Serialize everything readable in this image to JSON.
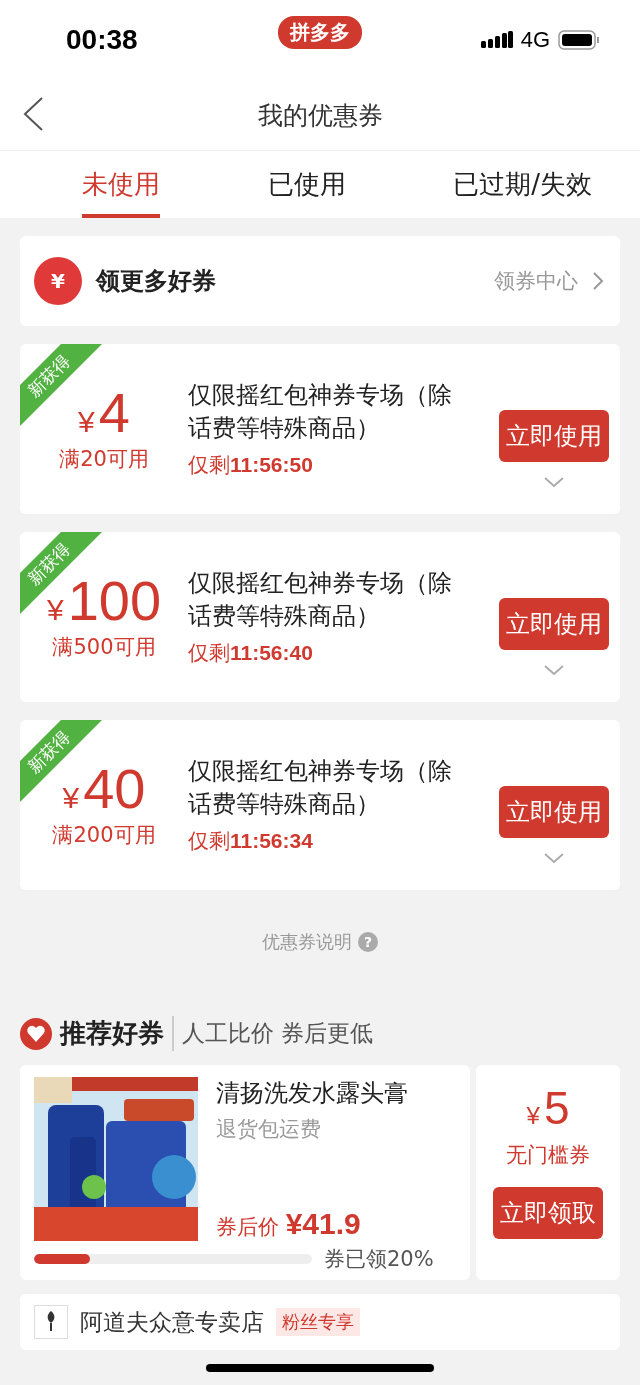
{
  "status_bar": {
    "time": "00:38",
    "app_badge": "拼多多",
    "network": "4G"
  },
  "nav": {
    "title": "我的优惠券"
  },
  "tabs": [
    {
      "label": "未使用",
      "selected": true
    },
    {
      "label": "已使用",
      "selected": false
    },
    {
      "label": "已过期/失效",
      "selected": false
    }
  ],
  "get_more": {
    "label": "领更多好券",
    "icon_char": "¥",
    "link": "领券中心"
  },
  "coupons": [
    {
      "tag": "新获得",
      "currency": "¥",
      "amount": "4",
      "condition": "满20可用",
      "title": "仅限摇红包神券专场（除话费等特殊商品）",
      "remaining_label": "仅剩",
      "remaining": "11:56:50",
      "button": "立即使用"
    },
    {
      "tag": "新获得",
      "currency": "¥",
      "amount": "100",
      "condition": "满500可用",
      "title": "仅限摇红包神券专场（除话费等特殊商品）",
      "remaining_label": "仅剩",
      "remaining": "11:56:40",
      "button": "立即使用"
    },
    {
      "tag": "新获得",
      "currency": "¥",
      "amount": "40",
      "condition": "满200可用",
      "title": "仅限摇红包神券专场（除话费等特殊商品）",
      "remaining_label": "仅剩",
      "remaining": "11:56:34",
      "button": "立即使用"
    }
  ],
  "explanation": {
    "label": "优惠券说明",
    "icon_char": "?"
  },
  "recommend": {
    "title": "推荐好券",
    "subtitle": "人工比价 券后更低",
    "product": {
      "name": "清扬洗发水露头膏",
      "note": "退货包运费",
      "price_label": "券后价",
      "price": "¥41.9",
      "level": 0.2,
      "claimed": "券已领20%",
      "coupon_currency": "¥",
      "coupon_amount": "5",
      "coupon_type": "无门槛券",
      "button": "立即领取"
    },
    "store": {
      "name": "阿道夫众意专卖店",
      "tag": "粉丝专享"
    }
  }
}
